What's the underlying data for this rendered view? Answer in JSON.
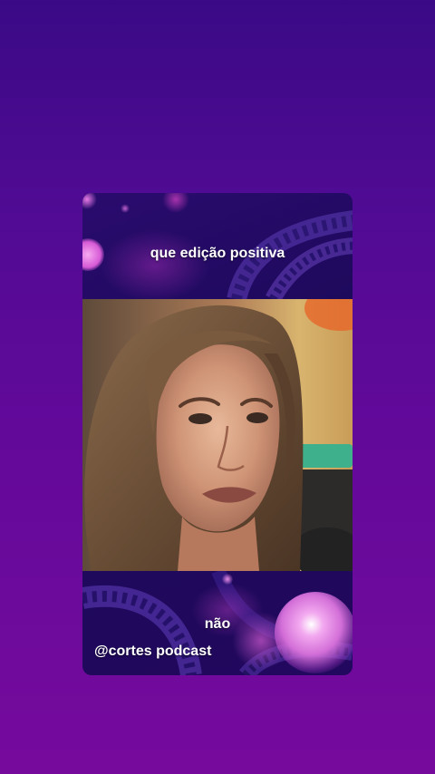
{
  "card": {
    "caption_top": "que edição positiva",
    "caption_bottom": "não",
    "handle": "@cortes podcast"
  },
  "video": {
    "description_icon": "speaker-video-frame"
  },
  "colors": {
    "background_top": "#3a0a86",
    "background_bottom": "#760a9d",
    "card_bg": "#1c0a5a",
    "accent_bokeh": "#e85ad8"
  }
}
